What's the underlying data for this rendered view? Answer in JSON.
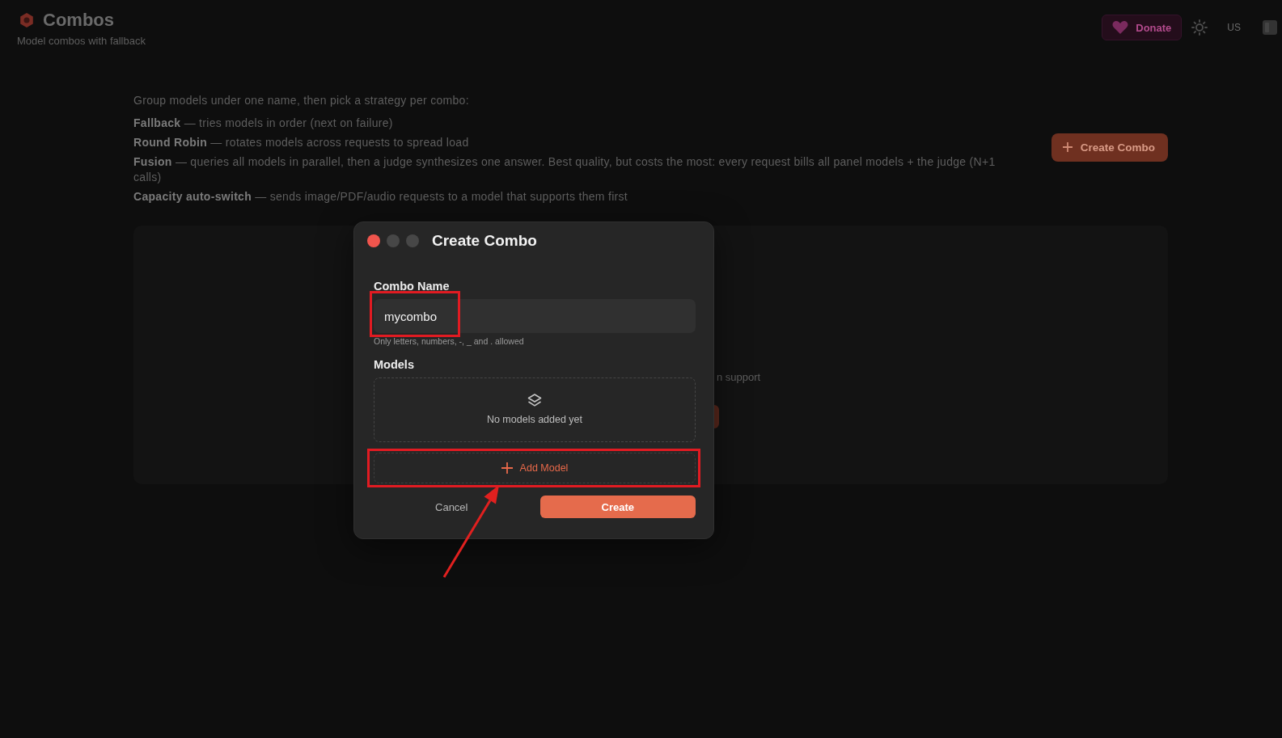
{
  "header": {
    "title": "Combos",
    "subtitle": "Model combos with fallback"
  },
  "top_bar": {
    "donate_label": "Donate",
    "language": "US"
  },
  "intro": {
    "lead": "Group models under one name, then pick a strategy per combo:",
    "strategies": [
      "**Fallback** — tries models in order (next on failure)",
      "**Round Robin** — rotates models across requests to spread load",
      "**Fusion** — queries all models in parallel, then a judge synthesizes one answer. Best quality, but costs the most: every request bills all panel models + the judge (N+1 calls)",
      "**Capacity auto-switch** — sends image/PDF/audio requests to a model that supports them first"
    ]
  },
  "create_combo_button": "Create Combo",
  "empty_state": {
    "text_fragment": "n support"
  },
  "dialog": {
    "title": "Create Combo",
    "window_controls": [
      {
        "color": "#f0554d"
      },
      {
        "color": "#474747"
      },
      {
        "color": "#474747"
      }
    ],
    "name_field": {
      "label": "Combo Name",
      "value": "mycombo",
      "hint": "Only letters, numbers, -, _ and . allowed",
      "highlighted": true
    },
    "models": {
      "label": "Models",
      "empty_text": "No models added yet"
    },
    "add_model_button": {
      "label": "Add Model",
      "highlighted": true
    },
    "buttons": [
      {
        "label": "Cancel",
        "kind": "secondary"
      },
      {
        "label": "Create",
        "kind": "primary"
      }
    ]
  },
  "annotations": [
    {
      "kind": "arrow"
    }
  ]
}
